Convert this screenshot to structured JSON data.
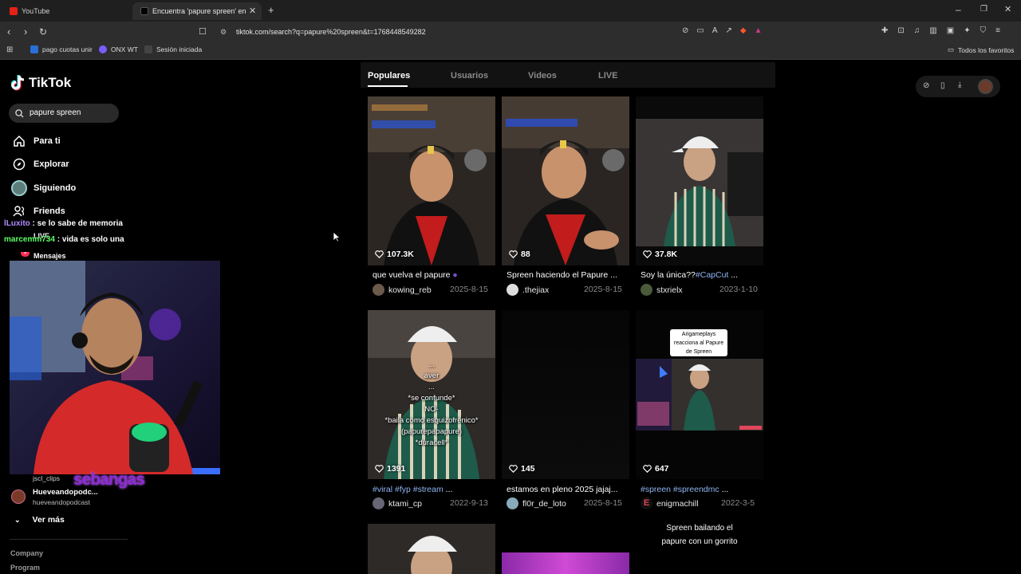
{
  "browser": {
    "tabs": [
      {
        "label": "YouTube"
      },
      {
        "label": "Encuentra 'papure spreen' en TikTok"
      }
    ],
    "new_tab_symbol": "+",
    "url": "tiktok.com/search?q=papure%20spreen&t=1768448549282",
    "bookmarks": [
      {
        "label": "pago cuotas unir"
      },
      {
        "label": "ONX WT"
      },
      {
        "label": "Sesión iniciada"
      }
    ],
    "all_bookmarks_label": "Todos los favoritos",
    "colors": {
      "tabbar": "#1f1f1f",
      "toolbar": "#2d2d2d",
      "youtube": "#e62117"
    }
  },
  "sidebar": {
    "logo": "TikTok",
    "search_value": "papure spreen",
    "nav": [
      {
        "label": "Para ti",
        "icon": "home-icon"
      },
      {
        "label": "Explorar",
        "icon": "compass-icon"
      },
      {
        "label": "Siguiendo",
        "icon": "avatar"
      },
      {
        "label": "Friends",
        "icon": "friends-icon"
      },
      {
        "label": "LIVE",
        "icon": "live-icon"
      },
      {
        "label": "Mensajes",
        "icon": "messages-icon",
        "badge": "3"
      }
    ],
    "following": [
      {
        "name": "jscl_clips",
        "handle": ""
      },
      {
        "name": "Hueveandopodc...",
        "handle": "hueveandopodcast"
      }
    ],
    "see_more": "Ver más",
    "footer": [
      "Company",
      "Program"
    ]
  },
  "stream_overlay": {
    "chat": [
      {
        "user": "lLuxito",
        "message": " : se lo sabe de memoria",
        "user_color": "#b38cff"
      },
      {
        "user": "marcemm734",
        "message": " : vida es solo una",
        "user_color": "#5cff66"
      }
    ],
    "watermark": "sebangas"
  },
  "search_tabs": [
    {
      "label": "Populares",
      "active": true
    },
    {
      "label": "Usuarios",
      "active": false
    },
    {
      "label": "Videos",
      "active": false
    },
    {
      "label": "LIVE",
      "active": false
    }
  ],
  "videos": [
    {
      "likes": "107.3K",
      "caption": "que vuelva el papure ",
      "caption_tag": "",
      "caption_suffix": "",
      "author": "kowing_reb",
      "date": "2025-8-15"
    },
    {
      "likes": "88",
      "caption": "Spreen haciendo el Papure ...",
      "caption_tag": "",
      "caption_suffix": "",
      "author": ".thejiax",
      "date": "2025-8-15"
    },
    {
      "likes": "37.8K",
      "caption": "Soy la única??",
      "caption_tag": "#CapCut",
      "caption_suffix": " ...",
      "author": "stxrielx",
      "date": "2023-1-10"
    },
    {
      "likes": "1391",
      "caption": "",
      "caption_tag": "#viral #fyp #stream",
      "caption_suffix": " ...",
      "author": "ktami_cp",
      "date": "2022-9-13",
      "overlay": [
        "...",
        "aver",
        "...",
        "*se confunde*",
        "NO-",
        "*baila como esquizofrénico*",
        "(papurepapapure)",
        "*duracell*"
      ]
    },
    {
      "likes": "145",
      "caption": "estamos en pleno 2025 jajaj...",
      "caption_tag": "",
      "caption_suffix": "",
      "author": "fl0r_de_loto",
      "date": "2025-8-15"
    },
    {
      "likes": "647",
      "caption": "",
      "caption_tag": "#spreen #spreendmc",
      "caption_suffix": " ...",
      "author": "enigmachill",
      "date": "2022-3-5",
      "overlay": [
        "Arigameplays",
        "reacciona al Papure",
        "de Spreen"
      ]
    }
  ],
  "next_row_overlay": [
    "Spreen bailando el",
    "papure con un gorrito"
  ]
}
